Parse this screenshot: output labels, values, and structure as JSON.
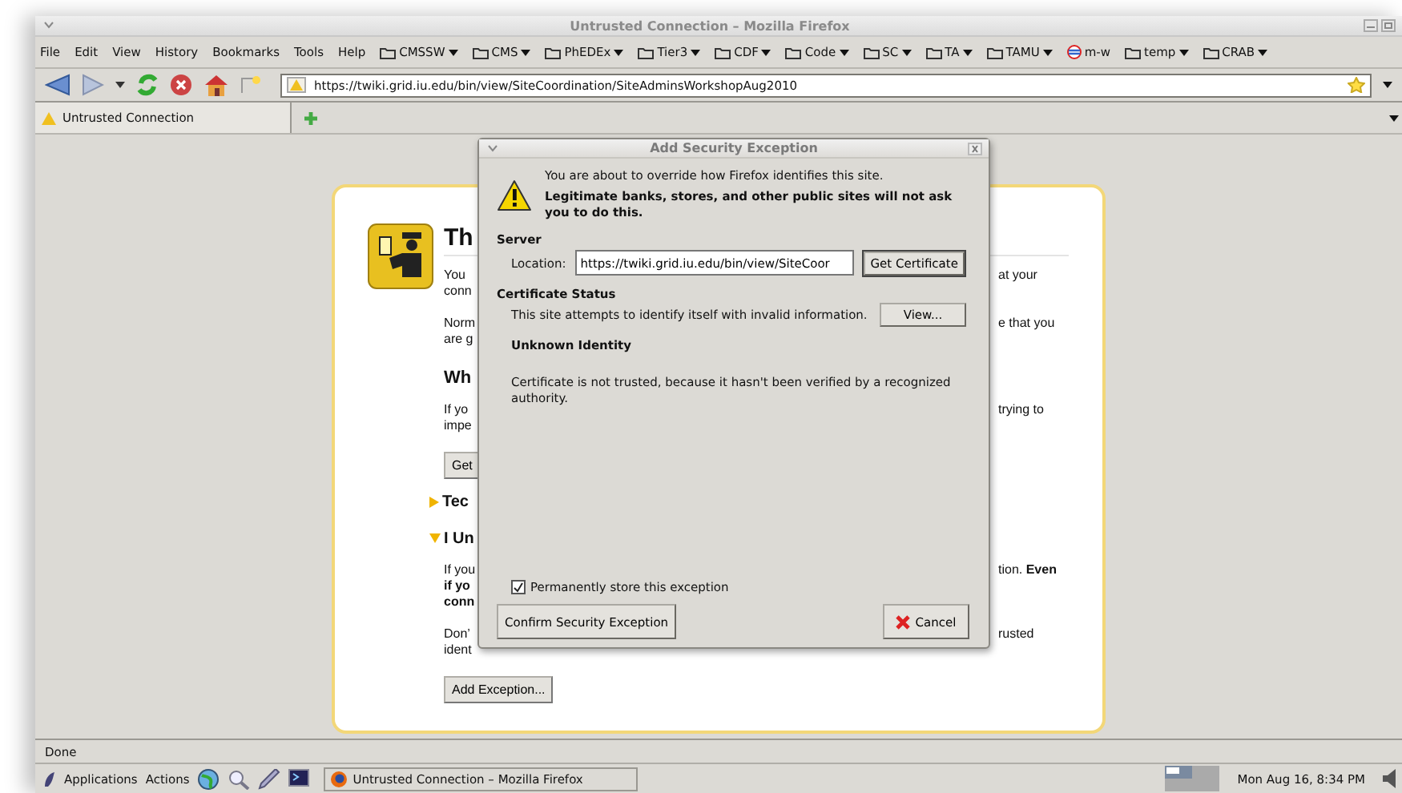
{
  "window": {
    "title": "Untrusted Connection – Mozilla Firefox"
  },
  "menu": [
    "File",
    "Edit",
    "View",
    "History",
    "Bookmarks",
    "Tools",
    "Help"
  ],
  "bookmarks": [
    {
      "label": "CMSSW",
      "kind": "folder"
    },
    {
      "label": "CMS",
      "kind": "folder"
    },
    {
      "label": "PhEDEx",
      "kind": "folder"
    },
    {
      "label": "Tier3",
      "kind": "folder"
    },
    {
      "label": "CDF",
      "kind": "folder"
    },
    {
      "label": "Code",
      "kind": "folder"
    },
    {
      "label": "SC",
      "kind": "folder"
    },
    {
      "label": "TA",
      "kind": "folder"
    },
    {
      "label": "TAMU",
      "kind": "folder"
    },
    {
      "label": "m-w",
      "kind": "link"
    },
    {
      "label": "temp",
      "kind": "folder"
    },
    {
      "label": "CRAB",
      "kind": "folder"
    }
  ],
  "address_bar": {
    "value": "https://twiki.grid.iu.edu/bin/view/SiteCoordination/SiteAdminsWorkshopAug2010"
  },
  "tabs": [
    {
      "label": "Untrusted Connection",
      "selected": true
    }
  ],
  "page": {
    "blocks": [
      {
        "kind": "title",
        "lines": [
          {
            "left": "Th"
          }
        ]
      },
      {
        "kind": "paragraph",
        "lines": [
          {
            "left": "You",
            "right": "at your"
          },
          {
            "left": "conn"
          }
        ]
      },
      {
        "kind": "paragraph",
        "lines": [
          {
            "left": "Norm",
            "right": "e that you"
          },
          {
            "left": "are g"
          }
        ]
      },
      {
        "kind": "heading",
        "lines": [
          {
            "left": "Wh"
          }
        ]
      },
      {
        "kind": "paragraph",
        "lines": [
          {
            "left": "If yo",
            "right": "trying to"
          },
          {
            "left": "impe"
          }
        ]
      },
      {
        "kind": "button",
        "label": "Get"
      },
      {
        "kind": "section",
        "label": "Tec",
        "expanded": false
      },
      {
        "kind": "section",
        "label": "I Un",
        "expanded": true
      },
      {
        "kind": "paragraph",
        "lines": [
          {
            "left": "If you",
            "right": "tion. **Even**"
          },
          {
            "left": "if yo",
            "bold": true
          },
          {
            "left": "conn",
            "bold": true
          }
        ]
      },
      {
        "kind": "paragraph",
        "lines": [
          {
            "left": "Don’",
            "right": "rusted"
          },
          {
            "left": "ident"
          }
        ]
      },
      {
        "kind": "button",
        "label": "Add Exception..."
      }
    ]
  },
  "dialog": {
    "title": "Add Security Exception",
    "warning": "You are about to override how Firefox identifies this site.",
    "warning_strong": "Legitimate banks, stores, and other public sites will not ask you to do this.",
    "server": {
      "heading": "Server",
      "location_label": "Location:",
      "location_value": "https://twiki.grid.iu.edu/bin/view/SiteCoor",
      "button": "Get Certificate"
    },
    "certificate_status": {
      "heading": "Certificate Status",
      "text": "This site attempts to identify itself with invalid information.",
      "button": "View...",
      "identity_heading": "Unknown Identity",
      "identity_text": "Certificate is not trusted, because it hasn't been verified by a recognized authority."
    },
    "permanent": {
      "label": "Permanently store this exception",
      "checked": true
    },
    "buttons": [
      {
        "label": "Confirm Security Exception",
        "kind": "confirm"
      },
      {
        "label": "Cancel",
        "kind": "cancel"
      }
    ]
  },
  "status_bar": {
    "text": "Done"
  },
  "taskbar": {
    "menus": [
      "Applications",
      "Actions"
    ],
    "tasks": [
      {
        "label": "Untrusted Connection – Mozilla Firefox"
      }
    ],
    "clock": "Mon Aug 16,  8:34 PM"
  }
}
